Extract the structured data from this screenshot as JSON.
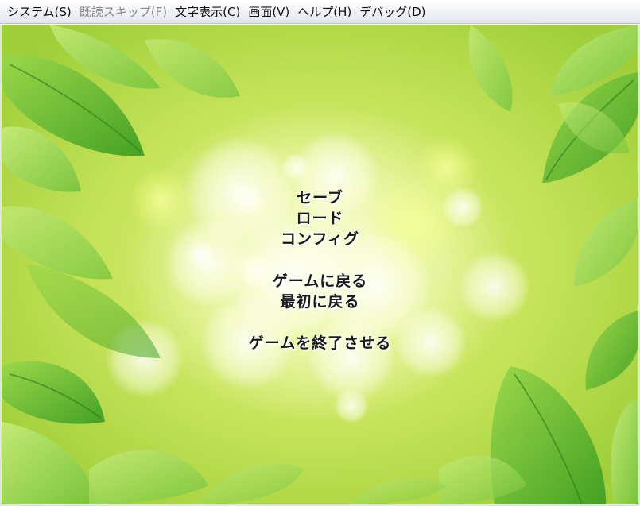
{
  "menubar": {
    "items": [
      {
        "label": "システム(S)",
        "enabled": true
      },
      {
        "label": "既読スキップ(F)",
        "enabled": false
      },
      {
        "label": "文字表示(C)",
        "enabled": true
      },
      {
        "label": "画面(V)",
        "enabled": true
      },
      {
        "label": "ヘルプ(H)",
        "enabled": true
      },
      {
        "label": "デバッグ(D)",
        "enabled": true
      }
    ]
  },
  "title_menu": {
    "save": "セーブ",
    "load": "ロード",
    "config": "コンフィグ",
    "return_to_game": "ゲームに戻る",
    "return_to_start": "最初に戻る",
    "quit_game": "ゲームを終了させる"
  },
  "background": {
    "icon": "leaves-bokeh-background",
    "colors": {
      "light": "#fbfde4",
      "mid": "#c6e35a",
      "leaf_dark": "#4fae2a",
      "leaf_light": "#a8dc5a"
    }
  }
}
